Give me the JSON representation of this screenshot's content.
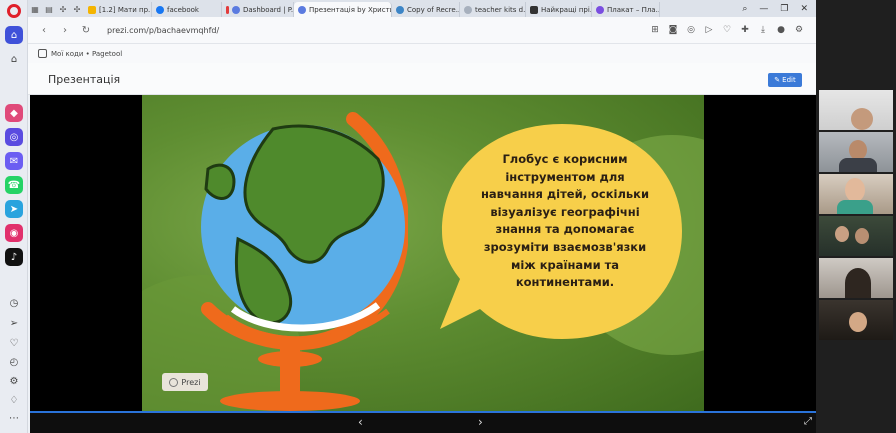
{
  "tabs": [
    {
      "label": "[1.2] Мати пр...",
      "color": "#f4b400",
      "active": false
    },
    {
      "label": "facebook",
      "color": "#1877f2",
      "active": false
    },
    {
      "label": "Dashboard | P...",
      "color": "#2b2b2b",
      "active": false
    },
    {
      "label": "Презентація by Христи...",
      "color": "#5b7be0",
      "active": true
    },
    {
      "label": "Copy of Recre...",
      "color": "#3d85c6",
      "active": false
    },
    {
      "label": "teacher kits d...",
      "color": "#a7b0bd",
      "active": false
    },
    {
      "label": "Найкращі прі...",
      "color": "#333333",
      "active": false
    },
    {
      "label": "Плакат – Пла...",
      "color": "#7a4ee0",
      "active": false
    }
  ],
  "toolbar": {
    "url": "prezi.com/p/bachaevmqhfd/"
  },
  "bookmarks": {
    "label": "Мої коди • Pagetool"
  },
  "page": {
    "title": "Презентація",
    "edit_label": "Edit"
  },
  "slide": {
    "text": "Глобус є корисним інструментом для навчання дітей, оскільки візуалізує географічні знання та допомагає зрозуміти взаємозв'язки між країнами та континентами.",
    "lines": [
      "Глобус є корисним",
      "інструментом для",
      "навчання дітей, оскільки",
      "візуалізує географічні",
      "знання та допомагає",
      "зрозуміти взаємозв'язки",
      "між країнами та",
      "континентами."
    ],
    "badge": "Prezi"
  },
  "colors": {
    "accent": "#2a73d9",
    "bubble": "#f7cf4a",
    "ocean": "#5aaee8",
    "land": "#4f8a2c",
    "stand": "#ef6a1c"
  }
}
